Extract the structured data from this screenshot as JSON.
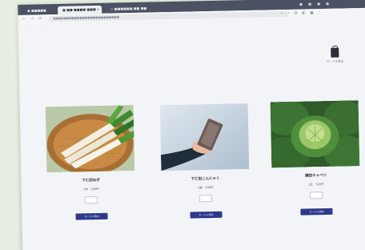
{
  "browser": {
    "tabs": [
      {
        "label": "● ■■■■■ ■■■"
      },
      {
        "label": "■ ■■ ■■■■ ■■■"
      },
      {
        "label": "○ ■■■■■■ ■■ ■■"
      }
    ],
    "url": "■■■■■■■■■■■■■■■■■■■■■■■■■"
  },
  "cart": {
    "label": "カートを見る"
  },
  "products": [
    {
      "name": "下仁田ねぎ",
      "price": "1本　200円",
      "button": "カートに追加"
    },
    {
      "name": "下仁田こんにゃく",
      "price": "1袋　200円",
      "button": "カートに追加"
    },
    {
      "name": "嬬恋キャベツ",
      "price": "1玉　300円",
      "button": "カートに追加"
    }
  ]
}
